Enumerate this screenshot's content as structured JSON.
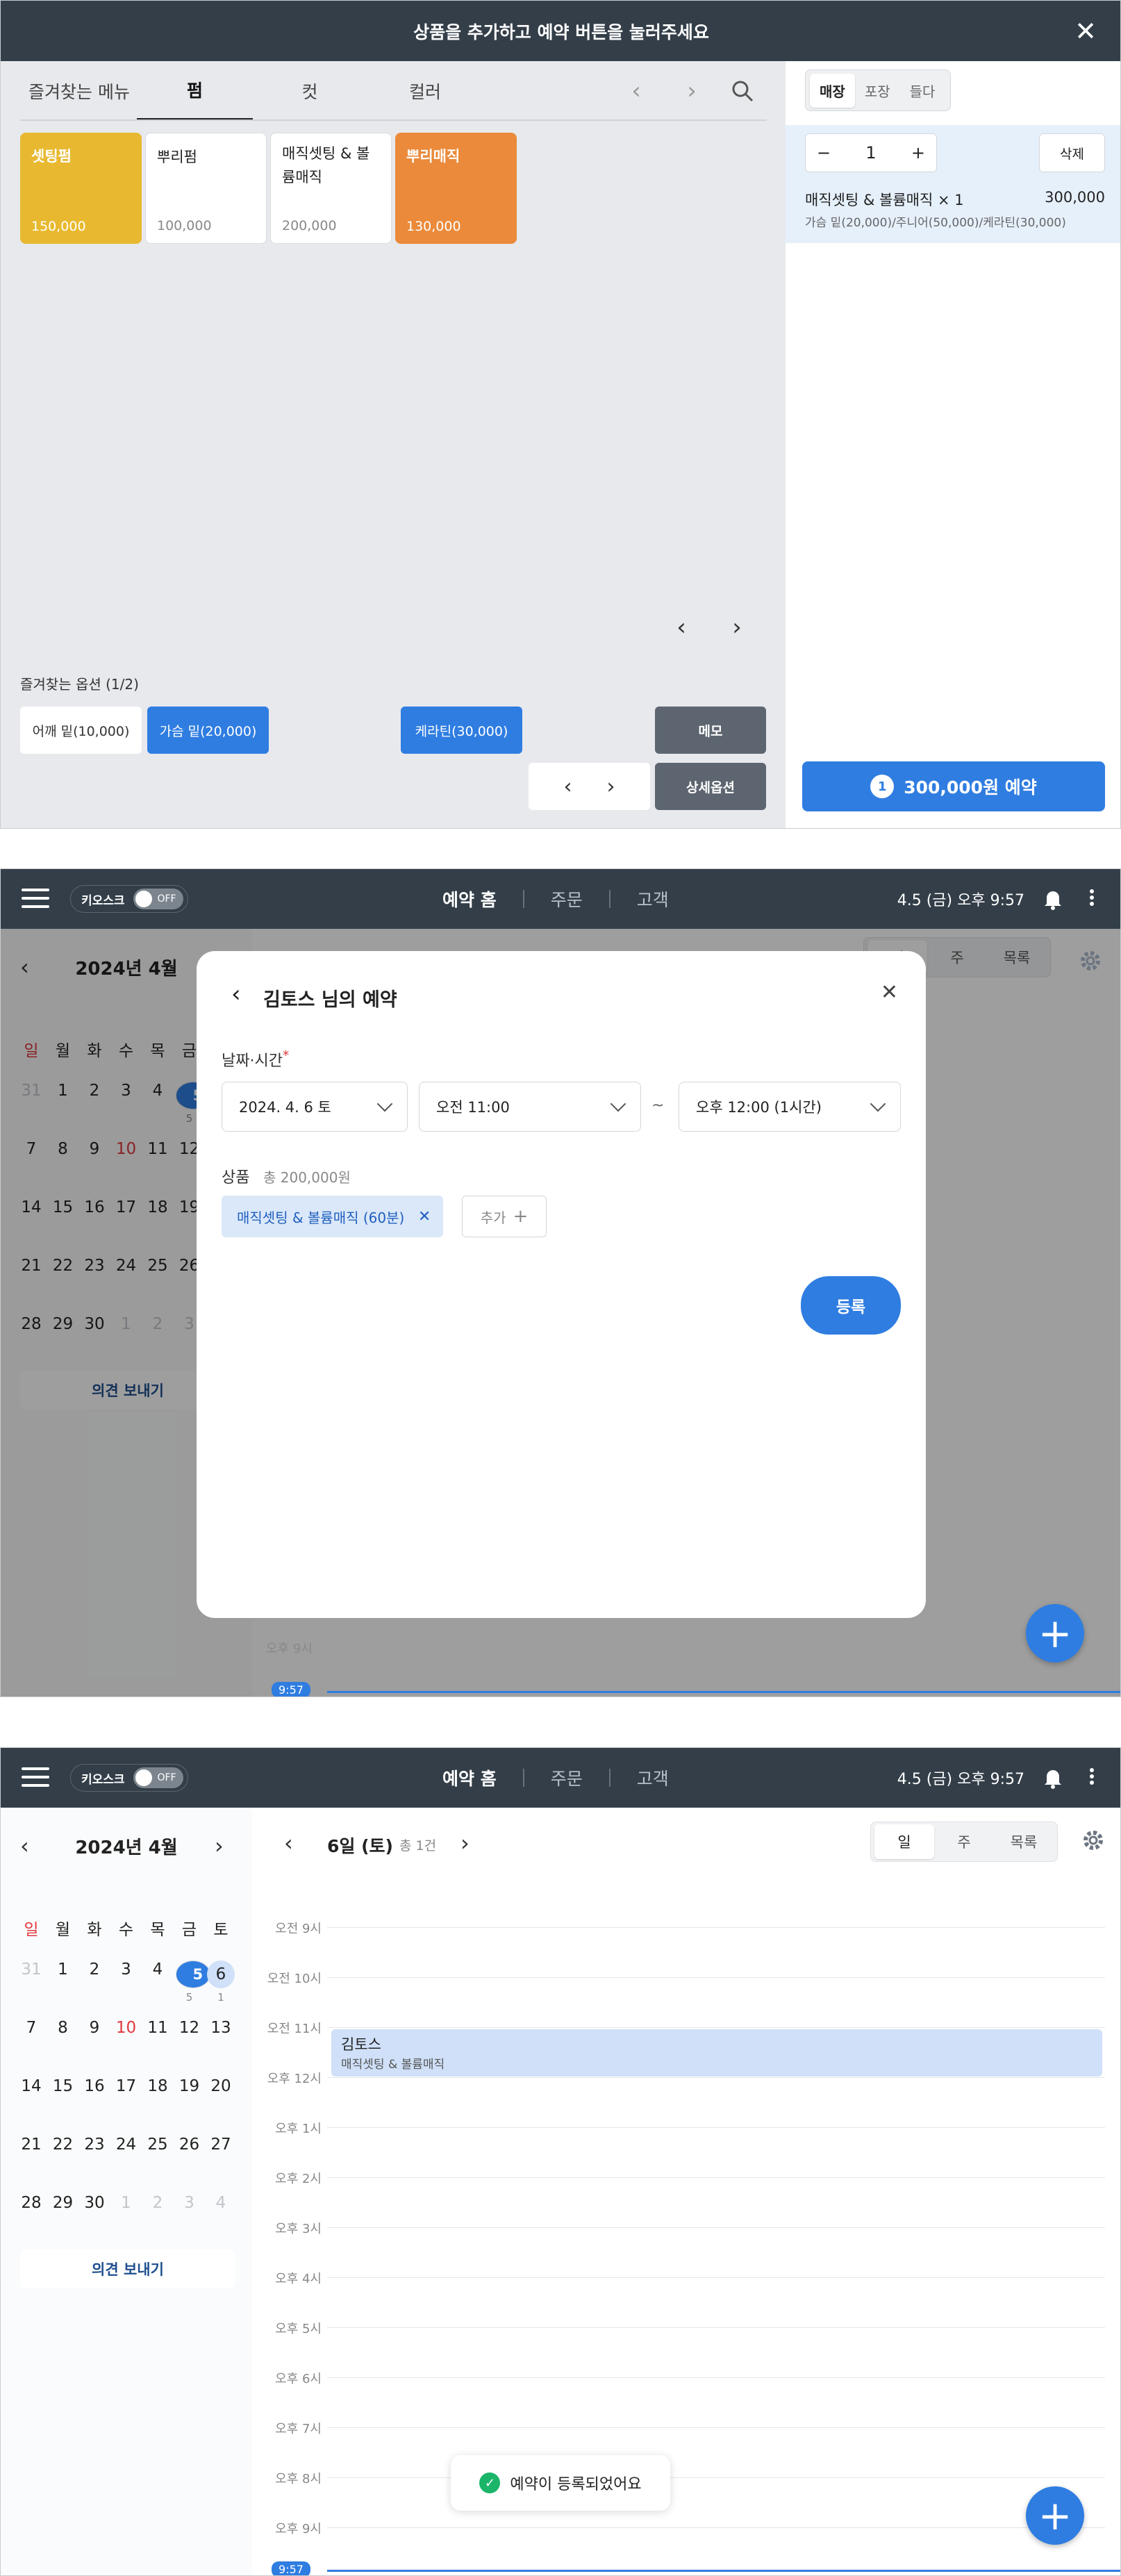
{
  "screen1": {
    "title": "상품을 추가하고 예약 버튼을 눌러주세요",
    "close_icon": "close-icon",
    "tabs": [
      "즐겨찾는 메뉴",
      "펌",
      "컷",
      "컬러"
    ],
    "active_tab": "펌",
    "products": [
      {
        "name": "셋팅펌",
        "price": "150,000",
        "color": "#e8b930"
      },
      {
        "name": "뿌리펌",
        "price": "100,000",
        "color": "#ffffff"
      },
      {
        "name": "매직셋팅 & 볼륨매직",
        "price": "200,000",
        "color": "#ffffff"
      },
      {
        "name": "뿌리매직",
        "price": "130,000",
        "color": "#ea8a3a"
      }
    ],
    "favorite_options_title": "즐겨찾는 옵션 (1/2)",
    "options": [
      {
        "label": "어깨 밑(10,000)",
        "selected": false
      },
      {
        "label": "가슴 밑(20,000)",
        "selected": true
      },
      {
        "label": "케라틴(30,000)",
        "selected": true
      }
    ],
    "memo_label": "메모",
    "detail_options_label": "상세옵션",
    "order_types": [
      "매장",
      "포장",
      "들다"
    ],
    "active_order_type": "매장",
    "quantity": "1",
    "delete_label": "삭제",
    "cart_item_name": "매직셋팅 & 볼륨매직 × 1",
    "cart_item_price": "300,000",
    "cart_item_options": "가슴 밑(20,000)/주니어(50,000)/케라틴(30,000)",
    "reserve_count": "1",
    "reserve_label": "300,000원 예약",
    "accent": "#2f7de1"
  },
  "header": {
    "kiosk_label": "키오스크",
    "kiosk_toggle": "OFF",
    "nav": [
      "예약 홈",
      "주문",
      "고객"
    ],
    "datetime": "4.5 (금) 오후 9:57"
  },
  "calendar": {
    "month": "2024년 4월",
    "weekdays": [
      "일",
      "월",
      "화",
      "수",
      "목",
      "금",
      "토"
    ],
    "weeks": [
      [
        "31",
        "1",
        "2",
        "3",
        "4",
        "5",
        "6"
      ],
      [
        "7",
        "8",
        "9",
        "10",
        "11",
        "12",
        "13"
      ],
      [
        "14",
        "15",
        "16",
        "17",
        "18",
        "19",
        "20"
      ],
      [
        "21",
        "22",
        "23",
        "24",
        "25",
        "26",
        "27"
      ],
      [
        "28",
        "29",
        "30",
        "1",
        "2",
        "3",
        "4"
      ]
    ],
    "today": "5",
    "selected": "6",
    "counts": {
      "5": "5",
      "6": "1"
    },
    "feedback_label": "의견 보내기"
  },
  "screen2": {
    "modal_title": "김토스 님의 예약",
    "datetime_label": "날짜·시간",
    "required_mark": "*",
    "date_value": "2024. 4. 6 토",
    "start_time": "오전 11:00",
    "tilde": "~",
    "end_time": "오후 12:00 (1시간)",
    "product_label": "상품",
    "product_total": "총 200,000원",
    "product_chip": "매직셋팅 & 볼륨매직 (60분)",
    "add_label": "추가",
    "register_label": "등록",
    "time_visible": "오후 9시",
    "now_label": "9:57"
  },
  "screen3": {
    "day_label": "6일 (토)",
    "day_count": "총 1건",
    "view_tabs": [
      "일",
      "주",
      "목록"
    ],
    "active_view": "일",
    "time_labels": [
      "오전 9시",
      "오전 10시",
      "오전 11시",
      "오후 12시",
      "오후 1시",
      "오후 2시",
      "오후 3시",
      "오후 4시",
      "오후 5시",
      "오후 6시",
      "오후 7시",
      "오후 8시",
      "오후 9시"
    ],
    "event_name": "김토스",
    "event_service": "매직셋팅 & 볼륨매직",
    "toast": "예약이 등록되었어요",
    "now_label": "9:57"
  }
}
